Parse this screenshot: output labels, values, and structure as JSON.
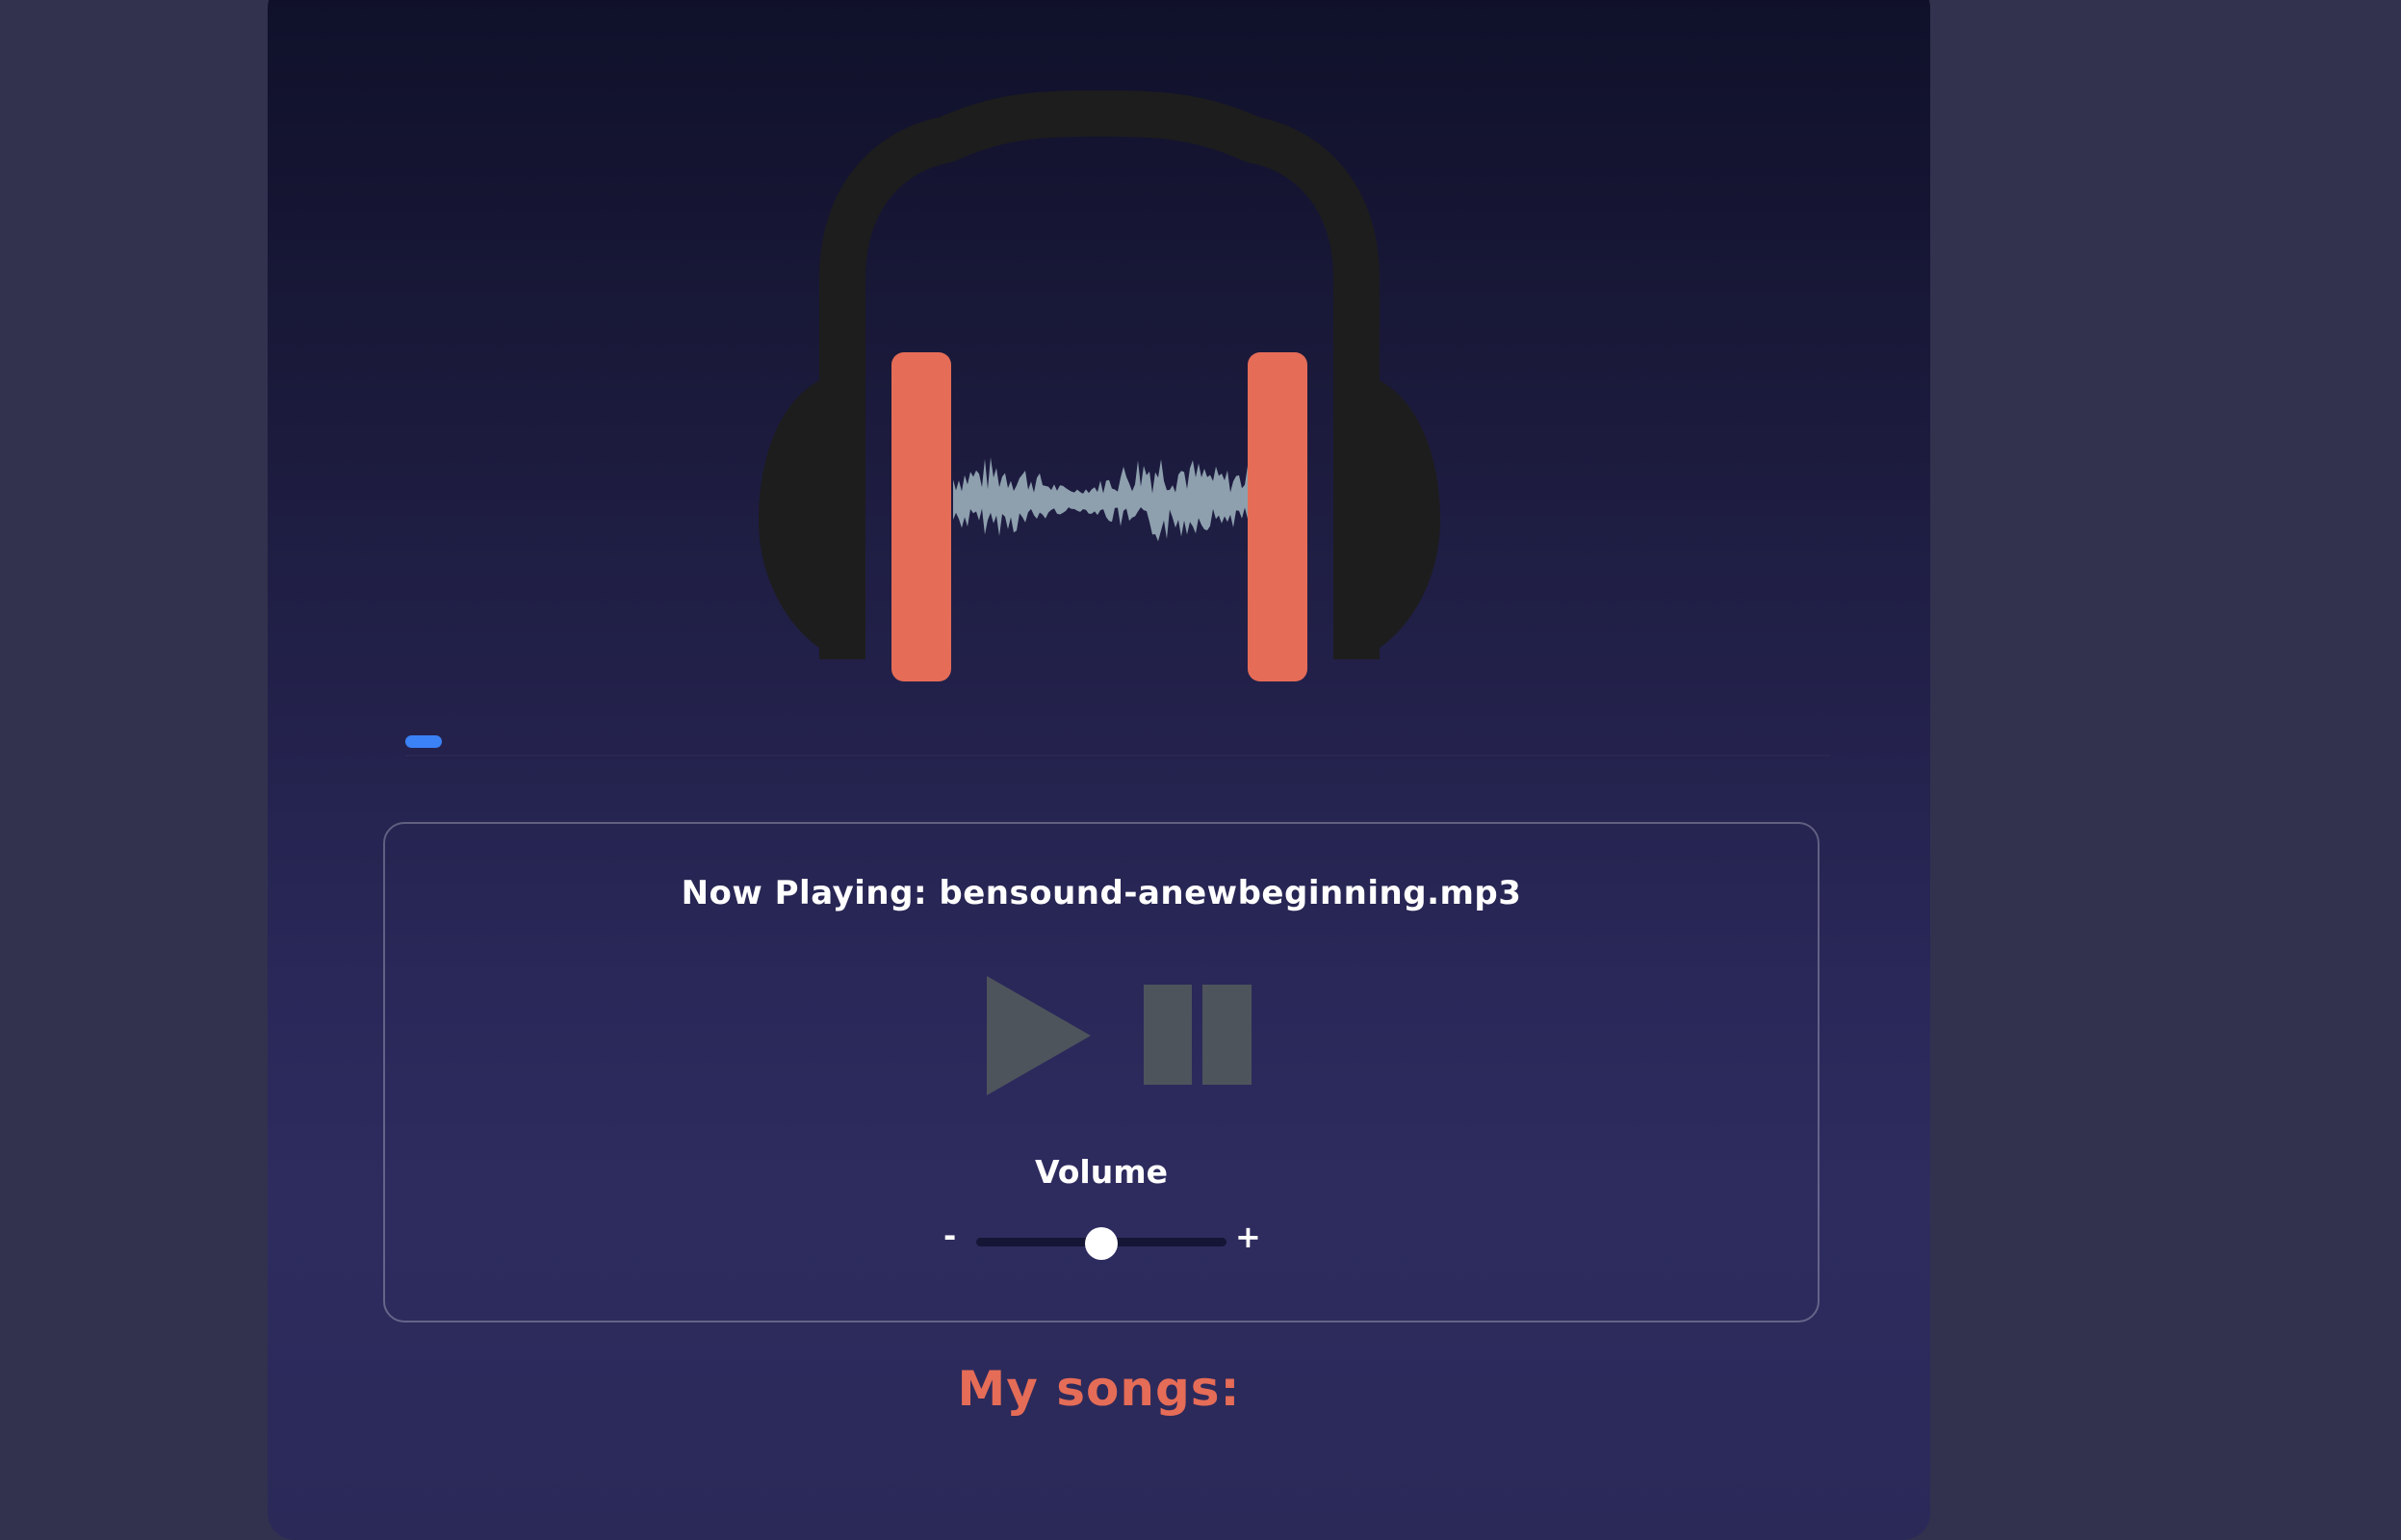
{
  "colors": {
    "page_background": "#32324e",
    "accent": "#e56c57",
    "progress": "#3a82f6",
    "band": "#1d1d1d",
    "waveform": "#8ea0ae",
    "control_icon": "#4d545c",
    "text": "#ffffff"
  },
  "player": {
    "artwork_icon": "headphones-waveform-icon",
    "progress_fraction": 0.025,
    "now_playing": "Now Playing: bensound-anewbeginning.mp3",
    "play_icon": "play-icon",
    "pause_icon": "pause-icon",
    "volume": {
      "label": "Volume",
      "minus": "-",
      "plus": "+",
      "level": 0.5
    }
  },
  "songs": {
    "heading": "My songs:"
  }
}
